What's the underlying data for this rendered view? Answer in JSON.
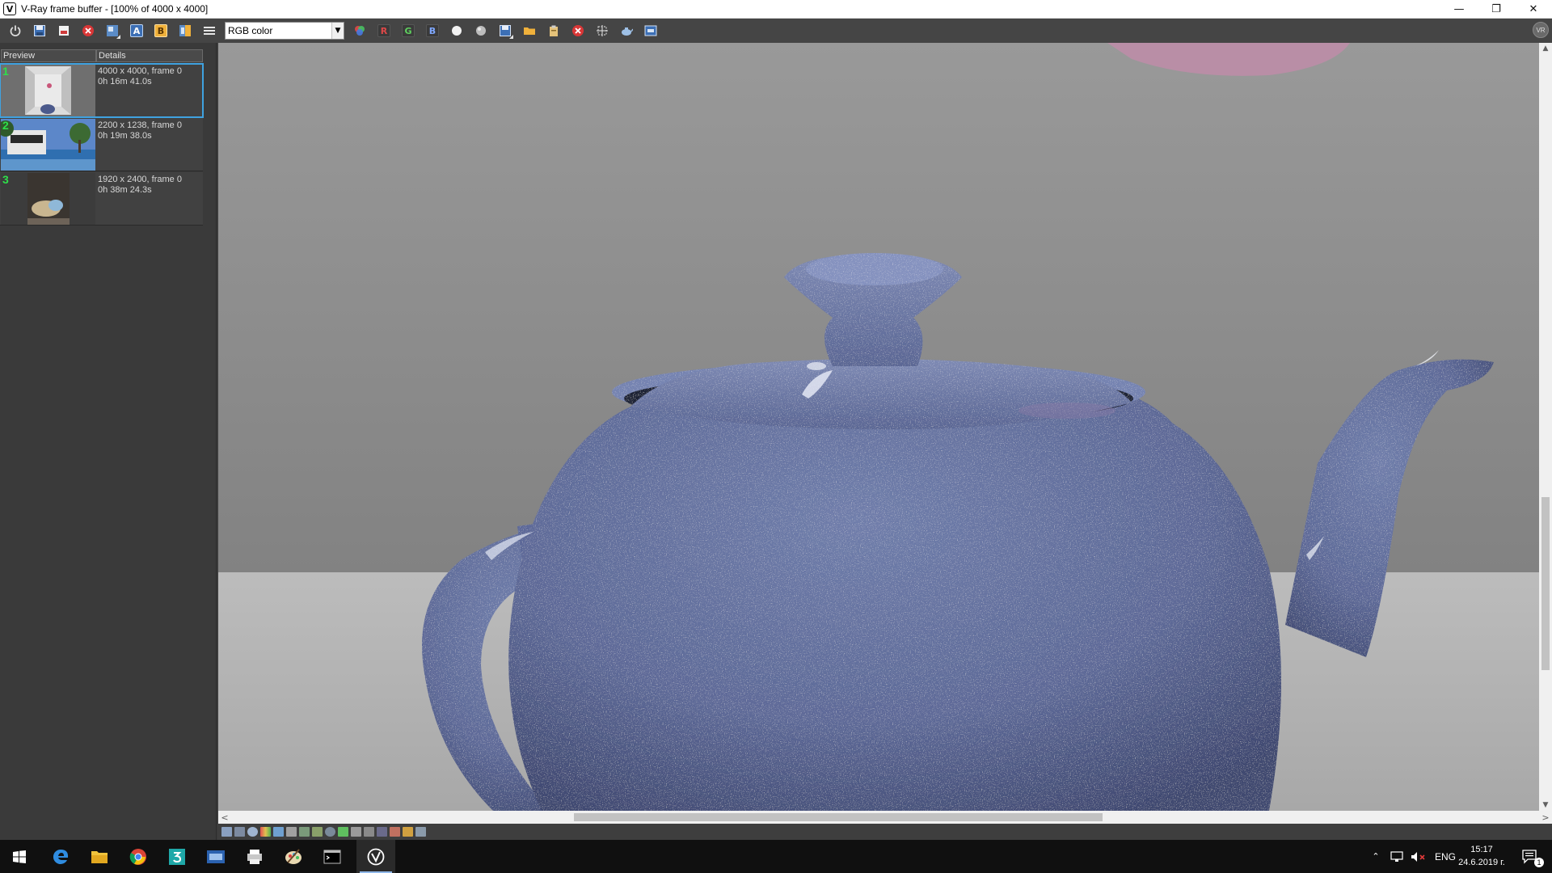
{
  "window": {
    "title": "V-Ray frame buffer - [100% of 4000 x 4000]",
    "logo_glyph": "V",
    "minimize_glyph": "—",
    "restore_glyph": "❐",
    "close_glyph": "✕"
  },
  "toolbar": {
    "channel_value": "RGB color",
    "dropdown_glyph": "▼",
    "red_label": "R",
    "green_label": "G",
    "blue_label": "B",
    "a_label": "A",
    "b_label": "B",
    "right_badge": "VR"
  },
  "history": {
    "columns": [
      "Preview",
      "Details"
    ],
    "items": [
      {
        "num": "1",
        "resolution": "4000 x 4000, frame 0",
        "time": "0h 16m 41.0s"
      },
      {
        "num": "2",
        "resolution": "2200 x 1238, frame 0",
        "time": "0h 19m 38.0s"
      },
      {
        "num": "3",
        "resolution": "1920 x 2400, frame 0",
        "time": "0h 38m 24.3s"
      }
    ]
  },
  "scrollbars": {
    "up": "▲",
    "down": "▼",
    "left": "<",
    "right": ">"
  },
  "taskbar": {
    "language": "ENG",
    "time": "15:17",
    "date": "24.6.2019 г.",
    "notification_count": "1"
  },
  "colors": {
    "teapot": "#5d6997",
    "background": "#8d8d8d",
    "selection": "#3fa2e0",
    "history_number": "#2ee04a"
  }
}
